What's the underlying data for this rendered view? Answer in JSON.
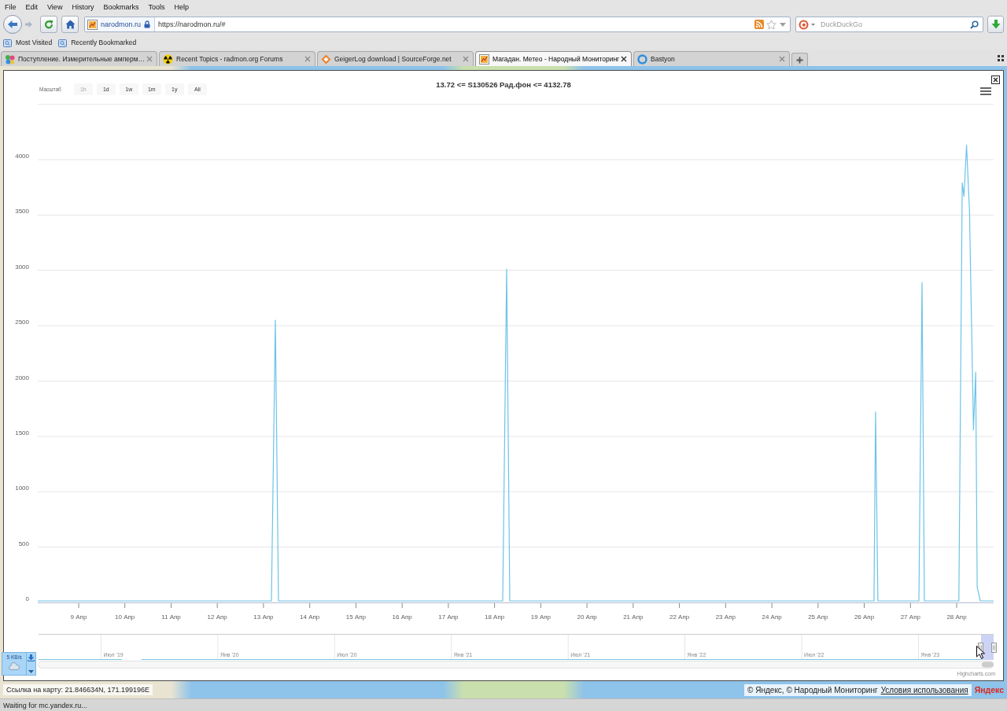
{
  "menu_bar": {
    "items": [
      "File",
      "Edit",
      "View",
      "History",
      "Bookmarks",
      "Tools",
      "Help"
    ]
  },
  "navigation_bar": {
    "forward_button": {
      "disabled": true
    },
    "site_identity": "narodmon.ru",
    "url": "https://narodmon.ru/#",
    "search": {
      "placeholder": "DuckDuckGo"
    }
  },
  "bookmarks_bar": {
    "items": [
      "Most Visited",
      "Recently Bookmarked"
    ]
  },
  "tabs": [
    {
      "title": "Поступление. Измерительные амперм…",
      "selected": false
    },
    {
      "title": "Recent Topics - radmon.org Forums",
      "selected": false
    },
    {
      "title": "GeigerLog download | SourceForge.net",
      "selected": false
    },
    {
      "title": "Магадан. Метео - Народный Мониторинг",
      "selected": true
    },
    {
      "title": "Bastyon",
      "selected": false
    }
  ],
  "chart_dialog": {
    "range_selector": {
      "label": "Масштаб",
      "buttons": [
        {
          "label": "1h",
          "disabled": true,
          "selected": false
        },
        {
          "label": "1d",
          "disabled": false,
          "selected": false
        },
        {
          "label": "1w",
          "disabled": false,
          "selected": false
        },
        {
          "label": "1m",
          "disabled": false,
          "selected": false
        },
        {
          "label": "1y",
          "disabled": false,
          "selected": false
        },
        {
          "label": "All",
          "disabled": false,
          "selected": false
        }
      ]
    },
    "chart_data": {
      "type": "line",
      "title": "13.72 <= S130526 Рад.фон <= 4132.78",
      "grid": true,
      "x": [
        8.115,
        13.171,
        13.256,
        13.324,
        18.176,
        18.261,
        18.329,
        26.211,
        26.245,
        26.296,
        27.182,
        27.25,
        27.301,
        28.047,
        28.12,
        28.159,
        28.214,
        28.278,
        28.365,
        28.411,
        28.445,
        28.51,
        28.8
      ],
      "series": [
        {
          "color": "#6cc3e8",
          "values": [
            14,
            14,
            2550,
            14,
            14,
            3010,
            14,
            14,
            1720,
            14,
            14,
            2890,
            14,
            14,
            3790,
            3670,
            4130,
            3540,
            1560,
            2080,
            140,
            14,
            14
          ]
        }
      ],
      "xlim": [
        8.115,
        28.8
      ],
      "ylim": [
        0,
        4500
      ],
      "xticks": [
        {
          "value": 9,
          "label": "9 Апр"
        },
        {
          "value": 10,
          "label": "10 Апр"
        },
        {
          "value": 11,
          "label": "11 Апр"
        },
        {
          "value": 12,
          "label": "12 Апр"
        },
        {
          "value": 13,
          "label": "13 Апр"
        },
        {
          "value": 14,
          "label": "14 Апр"
        },
        {
          "value": 15,
          "label": "15 Апр"
        },
        {
          "value": 16,
          "label": "16 Апр"
        },
        {
          "value": 17,
          "label": "17 Апр"
        },
        {
          "value": 18,
          "label": "18 Апр"
        },
        {
          "value": 19,
          "label": "19 Апр"
        },
        {
          "value": 20,
          "label": "20 Апр"
        },
        {
          "value": 21,
          "label": "21 Апр"
        },
        {
          "value": 22,
          "label": "22 Апр"
        },
        {
          "value": 23,
          "label": "23 Апр"
        },
        {
          "value": 24,
          "label": "24 Апр"
        },
        {
          "value": 25,
          "label": "25 Апр"
        },
        {
          "value": 26,
          "label": "26 Апр"
        },
        {
          "value": 27,
          "label": "27 Апр"
        },
        {
          "value": 28,
          "label": "28 Апр"
        }
      ],
      "yticks": [
        0,
        500,
        1000,
        1500,
        2000,
        2500,
        3000,
        3500,
        4000
      ]
    },
    "navigator": {
      "labels": [
        "Июл '19",
        "Янв '20",
        "Июл '20",
        "Янв '21",
        "Июл '21",
        "Янв '22",
        "Июл '22",
        "Янв '23"
      ]
    },
    "credit": "Highcharts.com"
  },
  "speed_widget": {
    "reading": "5 KB/s"
  },
  "map": {
    "coordinates_link": "Ссылка на карту: 21.846634N, 171.199196E",
    "attribution": "© Яндекс, © Народный Мониторинг",
    "terms_link": "Условия использования",
    "logo": "Яндекс"
  },
  "status_bar": {
    "text": "Waiting for mc.yandex.ru..."
  }
}
